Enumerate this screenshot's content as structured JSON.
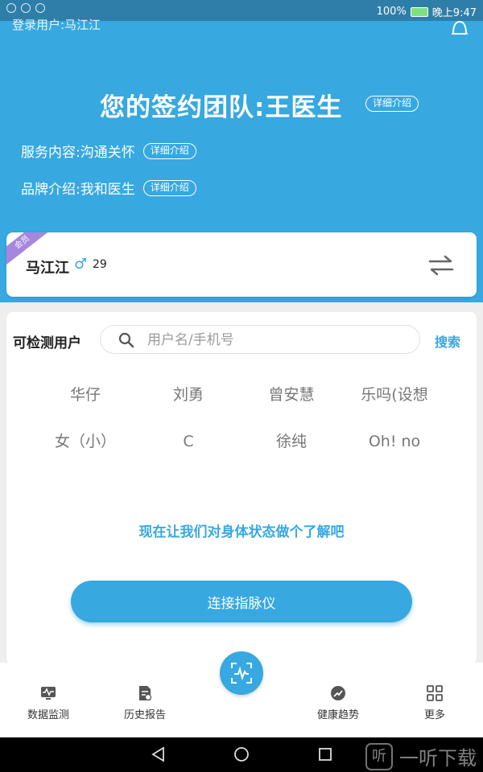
{
  "status_bar": {
    "battery": "100%",
    "time": "晚上9:47"
  },
  "hero": {
    "login_user": "登录用户:马江江",
    "team_title": "您的签约团队:王医生",
    "team_detail": "详细介绍",
    "service_label": "服务内容:沟通关怀",
    "service_detail": "详细介绍",
    "brand_label": "品牌介绍:我和医生",
    "brand_detail": "详细介绍"
  },
  "user_card": {
    "ribbon": "会员",
    "name": "马江江",
    "gender_symbol": "♂",
    "age": "29"
  },
  "panel": {
    "title": "可检测用户",
    "search_placeholder": "用户名/手机号",
    "search_button": "搜索",
    "users": [
      "华仔",
      "刘勇",
      "曾安慧",
      "乐吗(设想",
      "女（小）",
      "C",
      "徐纯",
      "Oh! no"
    ],
    "prompt": "现在让我们对身体状态做个了解吧",
    "connect_button": "连接指脉仪"
  },
  "tabs": [
    {
      "label": "数据监测",
      "icon": "monitor-icon"
    },
    {
      "label": "历史报告",
      "icon": "report-icon"
    },
    {
      "label": "健康趋势",
      "icon": "trend-icon"
    },
    {
      "label": "更多",
      "icon": "grid-icon"
    }
  ],
  "watermark": {
    "text": "一听下载",
    "logo_text": "听"
  },
  "colors": {
    "primary": "#37a8e0",
    "ribbon": "#a588dd"
  }
}
